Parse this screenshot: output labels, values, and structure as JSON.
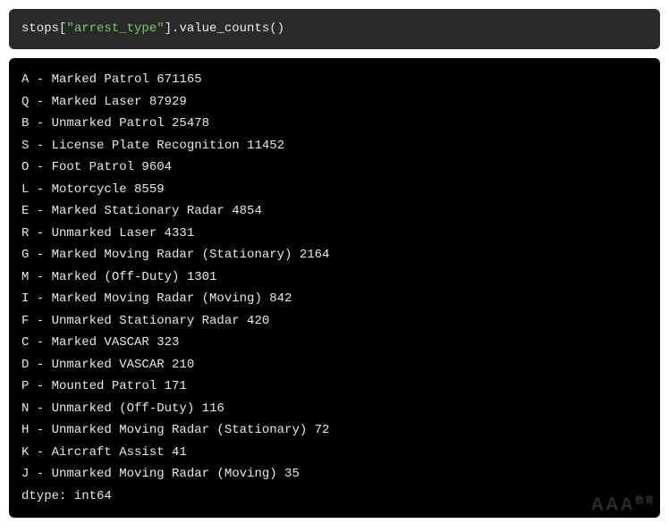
{
  "code": {
    "prefix": "stops[",
    "string": "\"arrest_type\"",
    "suffix": "].value_counts()"
  },
  "output": {
    "rows": [
      {
        "label": "A - Marked Patrol",
        "count": 671165
      },
      {
        "label": "Q - Marked Laser",
        "count": 87929
      },
      {
        "label": "B - Unmarked Patrol",
        "count": 25478
      },
      {
        "label": "S - License Plate Recognition",
        "count": 11452
      },
      {
        "label": "O - Foot Patrol",
        "count": 9604
      },
      {
        "label": "L - Motorcycle",
        "count": 8559
      },
      {
        "label": "E - Marked Stationary Radar",
        "count": 4854
      },
      {
        "label": "R - Unmarked Laser",
        "count": 4331
      },
      {
        "label": "G - Marked Moving Radar (Stationary)",
        "count": 2164
      },
      {
        "label": "M - Marked (Off-Duty)",
        "count": 1301
      },
      {
        "label": "I - Marked Moving Radar (Moving)",
        "count": 842
      },
      {
        "label": "F - Unmarked Stationary Radar",
        "count": 420
      },
      {
        "label": "C - Marked VASCAR",
        "count": 323
      },
      {
        "label": "D - Unmarked VASCAR",
        "count": 210
      },
      {
        "label": "P - Mounted Patrol",
        "count": 171
      },
      {
        "label": "N - Unmarked (Off-Duty)",
        "count": 116
      },
      {
        "label": "H - Unmarked Moving Radar (Stationary)",
        "count": 72
      },
      {
        "label": "K - Aircraft Assist",
        "count": 41
      },
      {
        "label": "J - Unmarked Moving Radar (Moving)",
        "count": 35
      }
    ],
    "dtype_line": "dtype: int64"
  },
  "watermark": {
    "main": "AAA",
    "sub": "教育"
  }
}
